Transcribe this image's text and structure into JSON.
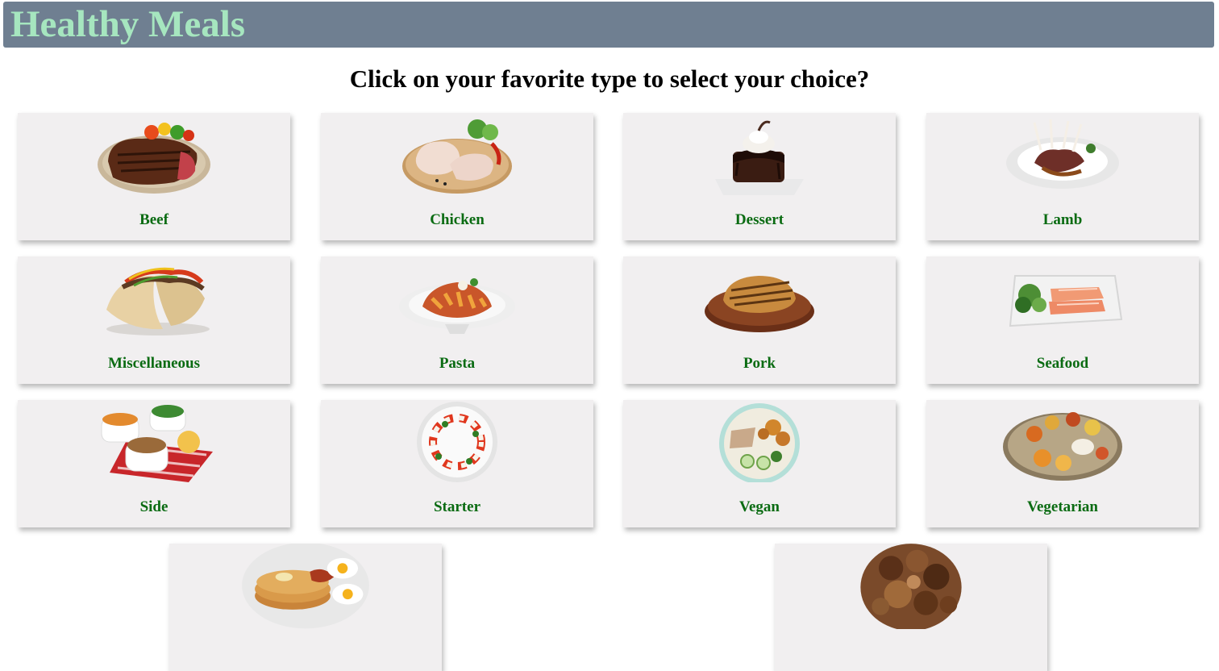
{
  "header": {
    "title": "Healthy Meals"
  },
  "subtitle": "Click on your favorite type to select your choice?",
  "categories": [
    {
      "label": "Beef",
      "icon": "steak-plate-image"
    },
    {
      "label": "Chicken",
      "icon": "raw-chicken-board-image"
    },
    {
      "label": "Dessert",
      "icon": "chocolate-cake-image"
    },
    {
      "label": "Lamb",
      "icon": "lamb-rack-plate-image"
    },
    {
      "label": "Miscellaneous",
      "icon": "tacos-image"
    },
    {
      "label": "Pasta",
      "icon": "penne-bowl-image"
    },
    {
      "label": "Pork",
      "icon": "pork-chop-board-image"
    },
    {
      "label": "Seafood",
      "icon": "salmon-tray-image"
    },
    {
      "label": "Side",
      "icon": "side-dishes-image"
    },
    {
      "label": "Starter",
      "icon": "caprese-plate-image"
    },
    {
      "label": "Vegan",
      "icon": "vegan-bowl-image"
    },
    {
      "label": "Vegetarian",
      "icon": "thali-platter-image"
    },
    {
      "label": "",
      "icon": "pancakes-eggs-image"
    },
    {
      "label": "",
      "icon": "grilled-meat-image"
    }
  ]
}
